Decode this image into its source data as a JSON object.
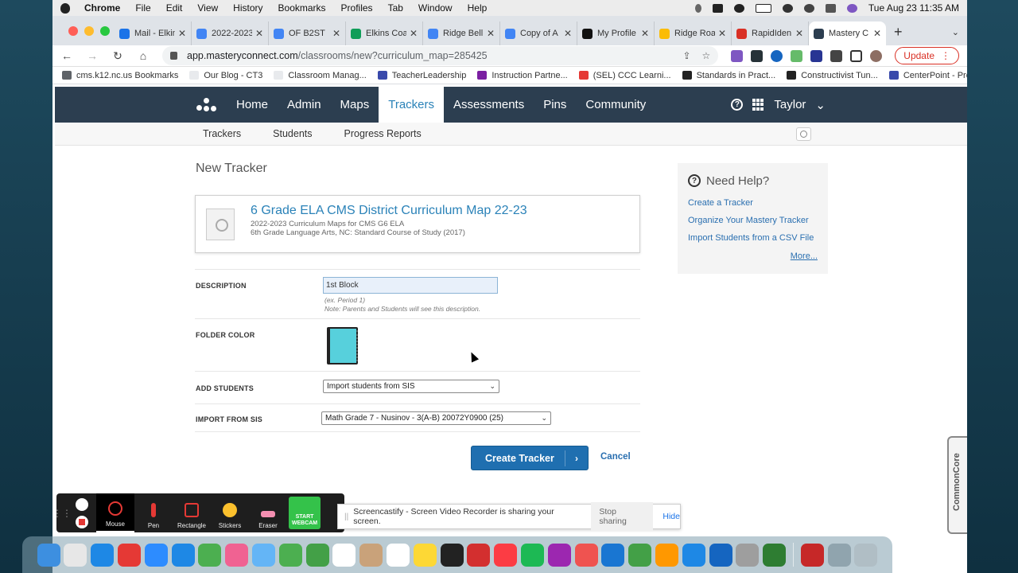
{
  "menubar": {
    "app": "Chrome",
    "items": [
      "File",
      "Edit",
      "View",
      "History",
      "Bookmarks",
      "Profiles",
      "Tab",
      "Window",
      "Help"
    ],
    "datetime": "Tue Aug 23  11:35 AM"
  },
  "tabs": [
    {
      "title": "Mail - Elkins",
      "color": "#1a73e8"
    },
    {
      "title": "2022-2023",
      "color": "#4285f4"
    },
    {
      "title": "OF B2ST",
      "color": "#4285f4"
    },
    {
      "title": "Elkins Coa",
      "color": "#0f9d58"
    },
    {
      "title": "Ridge Bell",
      "color": "#4285f4"
    },
    {
      "title": "Copy of A",
      "color": "#4285f4"
    },
    {
      "title": "My Profile",
      "color": "#111111"
    },
    {
      "title": "Ridge Roa",
      "color": "#fbbc04"
    },
    {
      "title": "RapidIden",
      "color": "#d93025"
    },
    {
      "title": "Mastery C",
      "color": "#2c3e50"
    }
  ],
  "url": {
    "host": "app.masteryconnect.com",
    "path": "/classrooms/new?curriculum_map=285425"
  },
  "update_label": "Update",
  "bookmarks": [
    {
      "label": "cms.k12.nc.us Bookmarks",
      "color": "#5f6368"
    },
    {
      "label": "Our Blog - CT3",
      "color": "#e8eaed"
    },
    {
      "label": "Classroom Manag...",
      "color": "#e8eaed"
    },
    {
      "label": "TeacherLeadership",
      "color": "#3949ab"
    },
    {
      "label": "Instruction Partne...",
      "color": "#7b1fa2"
    },
    {
      "label": "(SEL) CCC Learni...",
      "color": "#e53935"
    },
    {
      "label": "Standards in Pract...",
      "color": "#222222"
    },
    {
      "label": "Constructivist Tun...",
      "color": "#222222"
    },
    {
      "label": "CenterPoint - Prot...",
      "color": "#3949ab"
    }
  ],
  "appnav": {
    "items": [
      "Home",
      "Admin",
      "Maps",
      "Trackers",
      "Assessments",
      "Pins",
      "Community"
    ],
    "active": "Trackers",
    "user": "Taylor"
  },
  "subnav": [
    "Trackers",
    "Students",
    "Progress Reports"
  ],
  "page": {
    "title": "New Tracker",
    "map": {
      "title": "6 Grade ELA CMS District Curriculum Map 22-23",
      "line1": "2022-2023 Curriculum Maps for CMS G6 ELA",
      "line2": "6th Grade Language Arts, NC: Standard Course of Study (2017)"
    },
    "description": {
      "label": "DESCRIPTION",
      "value": "1st Block",
      "hint1": "(ex. Period 1)",
      "hint2": "Note: Parents and Students will see this description."
    },
    "folder_color": {
      "label": "FOLDER COLOR",
      "color": "#57d0dc"
    },
    "add_students": {
      "label": "ADD STUDENTS",
      "value": "Import students from SIS"
    },
    "import_sis": {
      "label": "IMPORT FROM SIS",
      "value": "Math Grade 7 - Nusinov - 3(A-B) 20072Y0900 (25)"
    },
    "create_label": "Create Tracker",
    "cancel_label": "Cancel"
  },
  "help": {
    "title": "Need Help?",
    "links": [
      "Create a Tracker",
      "Organize Your Mastery Tracker",
      "Import Students from a CSV File"
    ],
    "more": "More..."
  },
  "commoncore_tab": "CommonCore",
  "screencastify": {
    "tools": [
      {
        "label": "Mouse",
        "color": "#e53935"
      },
      {
        "label": "Pen",
        "color": "#e53935"
      },
      {
        "label": "Rectangle",
        "color": "#e53935"
      },
      {
        "label": "Stickers",
        "color": "#fbc02d"
      },
      {
        "label": "Eraser",
        "color": "#f48fb1"
      }
    ],
    "webcam_line1": "START",
    "webcam_line2": "WEBCAM",
    "share_message": "Screencastify - Screen Video Recorder is sharing your screen.",
    "stop_label": "Stop sharing",
    "hide_label": "Hide"
  },
  "dock_colors": [
    "#3d8fe0",
    "#e7e7e7",
    "#1e88e5",
    "#e53935",
    "#2d8cff",
    "#1e88e5",
    "#4caf50",
    "#f06292",
    "#64b5f6",
    "#4caf50",
    "#43a047",
    "#ffffff",
    "#c9a27a",
    "#ffffff",
    "#fdd835",
    "#222222",
    "#d32f2f",
    "#fc3c44",
    "#1db954",
    "#9c27b0",
    "#ef5350",
    "#1976d2",
    "#43a047",
    "#ff9800",
    "#1e88e5",
    "#1565c0",
    "#9e9e9e",
    "#2e7d32",
    "#c62828",
    "#90a4ae",
    "#b0bec5"
  ]
}
